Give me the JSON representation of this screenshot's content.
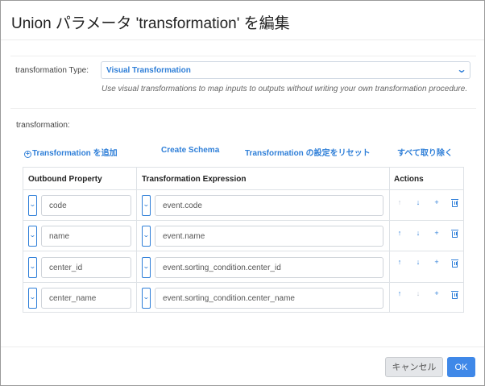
{
  "dialog": {
    "title": "Union パラメータ 'transformation' を編集"
  },
  "transformation_type": {
    "label": "transformation Type:",
    "selected": "Visual Transformation",
    "help": "Use visual transformations to map inputs to outputs without writing your own transformation procedure."
  },
  "transformation": {
    "label": "transformation:"
  },
  "actions": {
    "add": "Transformation を追加",
    "create_schema": "Create Schema",
    "reset": "Transformation の設定をリセット",
    "remove_all": "すべて取り除く"
  },
  "table": {
    "headers": {
      "outbound": "Outbound Property",
      "expression": "Transformation Expression",
      "actions": "Actions"
    },
    "rows": [
      {
        "property": "code",
        "expression": "event.code",
        "up_enabled": false,
        "down_enabled": true
      },
      {
        "property": "name",
        "expression": "event.name",
        "up_enabled": true,
        "down_enabled": true
      },
      {
        "property": "center_id",
        "expression": "event.sorting_condition.center_id",
        "up_enabled": true,
        "down_enabled": true
      },
      {
        "property": "center_name",
        "expression": "event.sorting_condition.center_name",
        "up_enabled": true,
        "down_enabled": false
      }
    ]
  },
  "icons": {
    "up": "arrow-up-icon",
    "down": "arrow-down-icon",
    "add": "plus-icon",
    "delete": "trash-icon",
    "dropdown": "chevron-down-icon"
  },
  "footer": {
    "cancel": "キャンセル",
    "ok": "OK"
  },
  "colors": {
    "accent": "#2f7fd8",
    "primary_button": "#3f88e8",
    "disabled_icon": "#bdc7d3"
  }
}
